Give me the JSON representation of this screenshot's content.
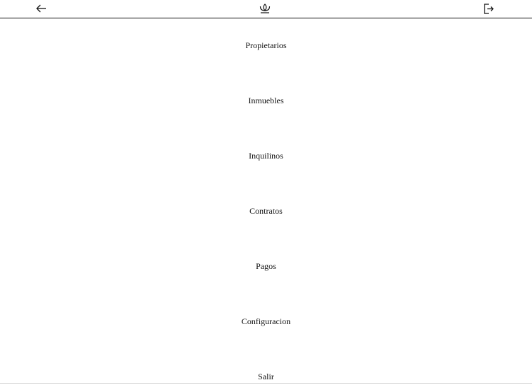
{
  "header": {
    "back_icon": "arrow-left-icon",
    "logo_icon": "lotus-logo-icon",
    "logout_icon": "logout-icon"
  },
  "menu": {
    "items": [
      {
        "label": "Propietarios"
      },
      {
        "label": "Inmuebles"
      },
      {
        "label": "Inquilinos"
      },
      {
        "label": "Contratos"
      },
      {
        "label": "Pagos"
      },
      {
        "label": "Configuracion"
      },
      {
        "label": "Salir"
      }
    ]
  }
}
